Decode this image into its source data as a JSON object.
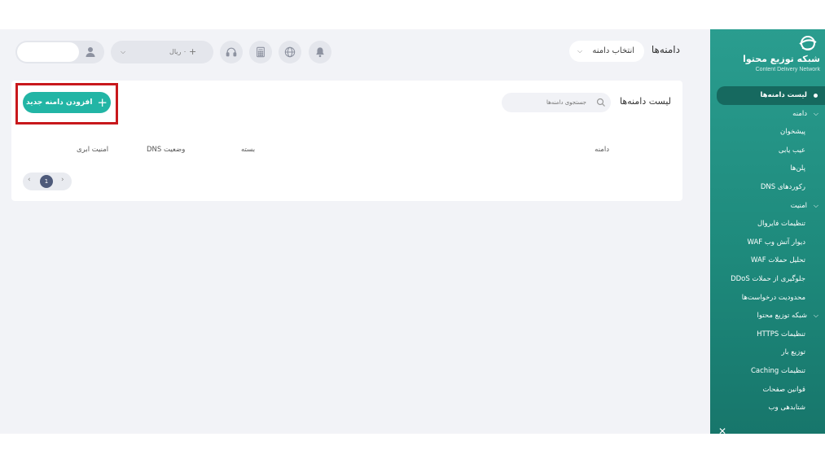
{
  "sidebar": {
    "brand_title": "شبکه توزیع محتوا",
    "brand_subtitle": "Content Delivery Network",
    "items": [
      {
        "label": "لیست دامنه‌ها",
        "active": true
      },
      {
        "label": "دامنه",
        "section": true
      },
      {
        "label": "پیشخوان"
      },
      {
        "label": "عیب یابی"
      },
      {
        "label": "پلن‌ها"
      },
      {
        "label": "رکوردهای DNS"
      },
      {
        "label": "امنیت",
        "section": true
      },
      {
        "label": "تنظیمات فایروال"
      },
      {
        "label": "دیوار آتش وب WAF"
      },
      {
        "label": "تحلیل حملات WAF"
      },
      {
        "label": "جلوگیری از حملات DDoS"
      },
      {
        "label": "محدودیت درخواست‌ها"
      },
      {
        "label": "شبکه توزیع محتوا",
        "section": true
      },
      {
        "label": "تنظیمات HTTPS"
      },
      {
        "label": "توزیع بار"
      },
      {
        "label": "تنظیمات Caching"
      },
      {
        "label": "قوانین صفحات"
      },
      {
        "label": "شتابدهی وب"
      }
    ]
  },
  "header": {
    "title": "دامنه‌ها",
    "domain_select": "انتخاب دامنه",
    "balance": "۰ ریال",
    "user_value": ""
  },
  "card": {
    "title": "لیست دامنه‌ها",
    "search_placeholder": "جستجوی دامنه‌ها",
    "add_button": "افزودن دامنه جدید",
    "columns": {
      "domain": "دامنه",
      "plan": "بسته",
      "dns_status": "وضعیت DNS",
      "cloud_security": "امنیت ابری"
    },
    "pagination": {
      "current_page": "1"
    }
  },
  "colors": {
    "sidebar": "#2a9d8f",
    "accent": "#22b5a5",
    "highlight": "#c8181c"
  },
  "icons": [
    "cdn-logo-icon",
    "bell-icon",
    "globe-icon",
    "calculator-icon",
    "headset-icon",
    "plus-icon",
    "user-icon",
    "search-icon",
    "chevron-down-icon"
  ]
}
